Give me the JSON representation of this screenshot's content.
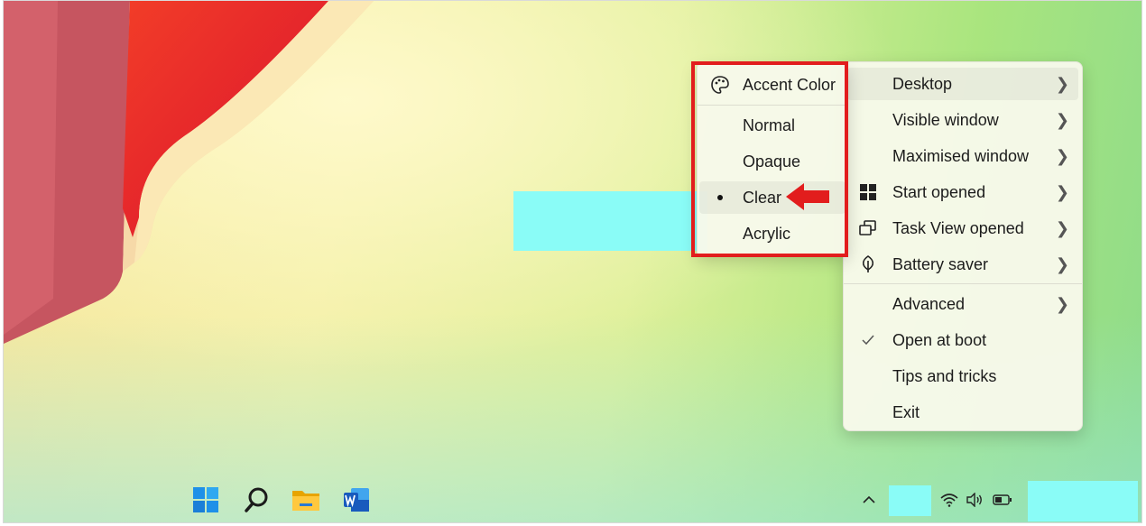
{
  "accent_menu": {
    "header": "Accent Color",
    "options": [
      "Normal",
      "Opaque",
      "Clear",
      "Acrylic"
    ],
    "selected": "Clear"
  },
  "main_menu": {
    "items": [
      {
        "label": "Desktop",
        "icon": "none",
        "submenu": true
      },
      {
        "label": "Visible window",
        "icon": "none",
        "submenu": true
      },
      {
        "label": "Maximised window",
        "icon": "none",
        "submenu": true
      },
      {
        "label": "Start opened",
        "icon": "windows-logo-icon",
        "submenu": true
      },
      {
        "label": "Task View opened",
        "icon": "task-view-icon",
        "submenu": true
      },
      {
        "label": "Battery saver",
        "icon": "leaf-icon",
        "submenu": true
      },
      {
        "label": "Advanced",
        "icon": "none",
        "submenu": true
      },
      {
        "label": "Open at boot",
        "icon": "checkmark-icon",
        "submenu": false
      },
      {
        "label": "Tips and tricks",
        "icon": "none",
        "submenu": false
      },
      {
        "label": "Exit",
        "icon": "none",
        "submenu": false
      }
    ]
  },
  "taskbar": {
    "apps": [
      "start-icon",
      "search-icon",
      "file-explorer-icon",
      "word-icon"
    ],
    "tray": [
      "chevron-up-icon",
      "wifi-icon",
      "volume-icon",
      "battery-icon"
    ]
  },
  "colors": {
    "highlight_border": "#e21d1d",
    "arrow": "#e21d1d",
    "redacted_block": "#8afcf7"
  }
}
